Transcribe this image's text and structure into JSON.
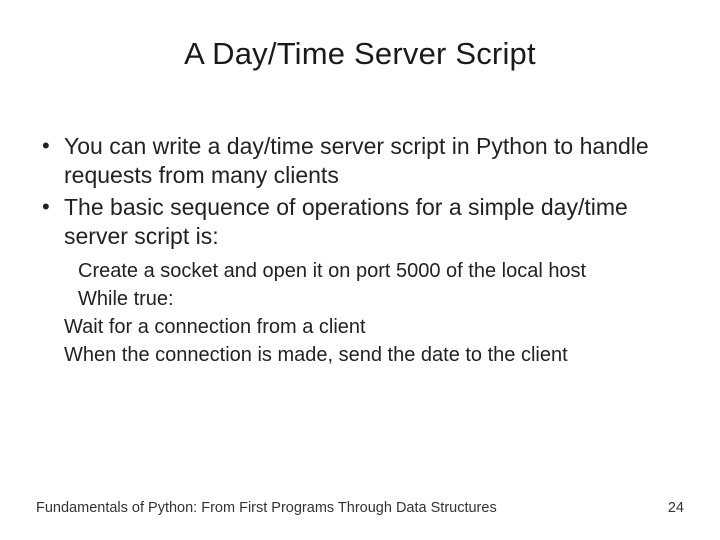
{
  "slide": {
    "title": "A Day/Time Server Script",
    "bullets": [
      "You can write a day/time server script in Python to handle requests from many clients",
      "The basic sequence of operations for a simple day/time server script is:"
    ],
    "subitems": [
      "Create a socket and open it on port 5000 of the local host",
      "While true:"
    ],
    "subsubitems": [
      "Wait for a connection from a client",
      "When the connection is made, send the date to the client"
    ],
    "footer_text": "Fundamentals of Python: From First Programs Through Data Structures",
    "page_number": "24"
  }
}
